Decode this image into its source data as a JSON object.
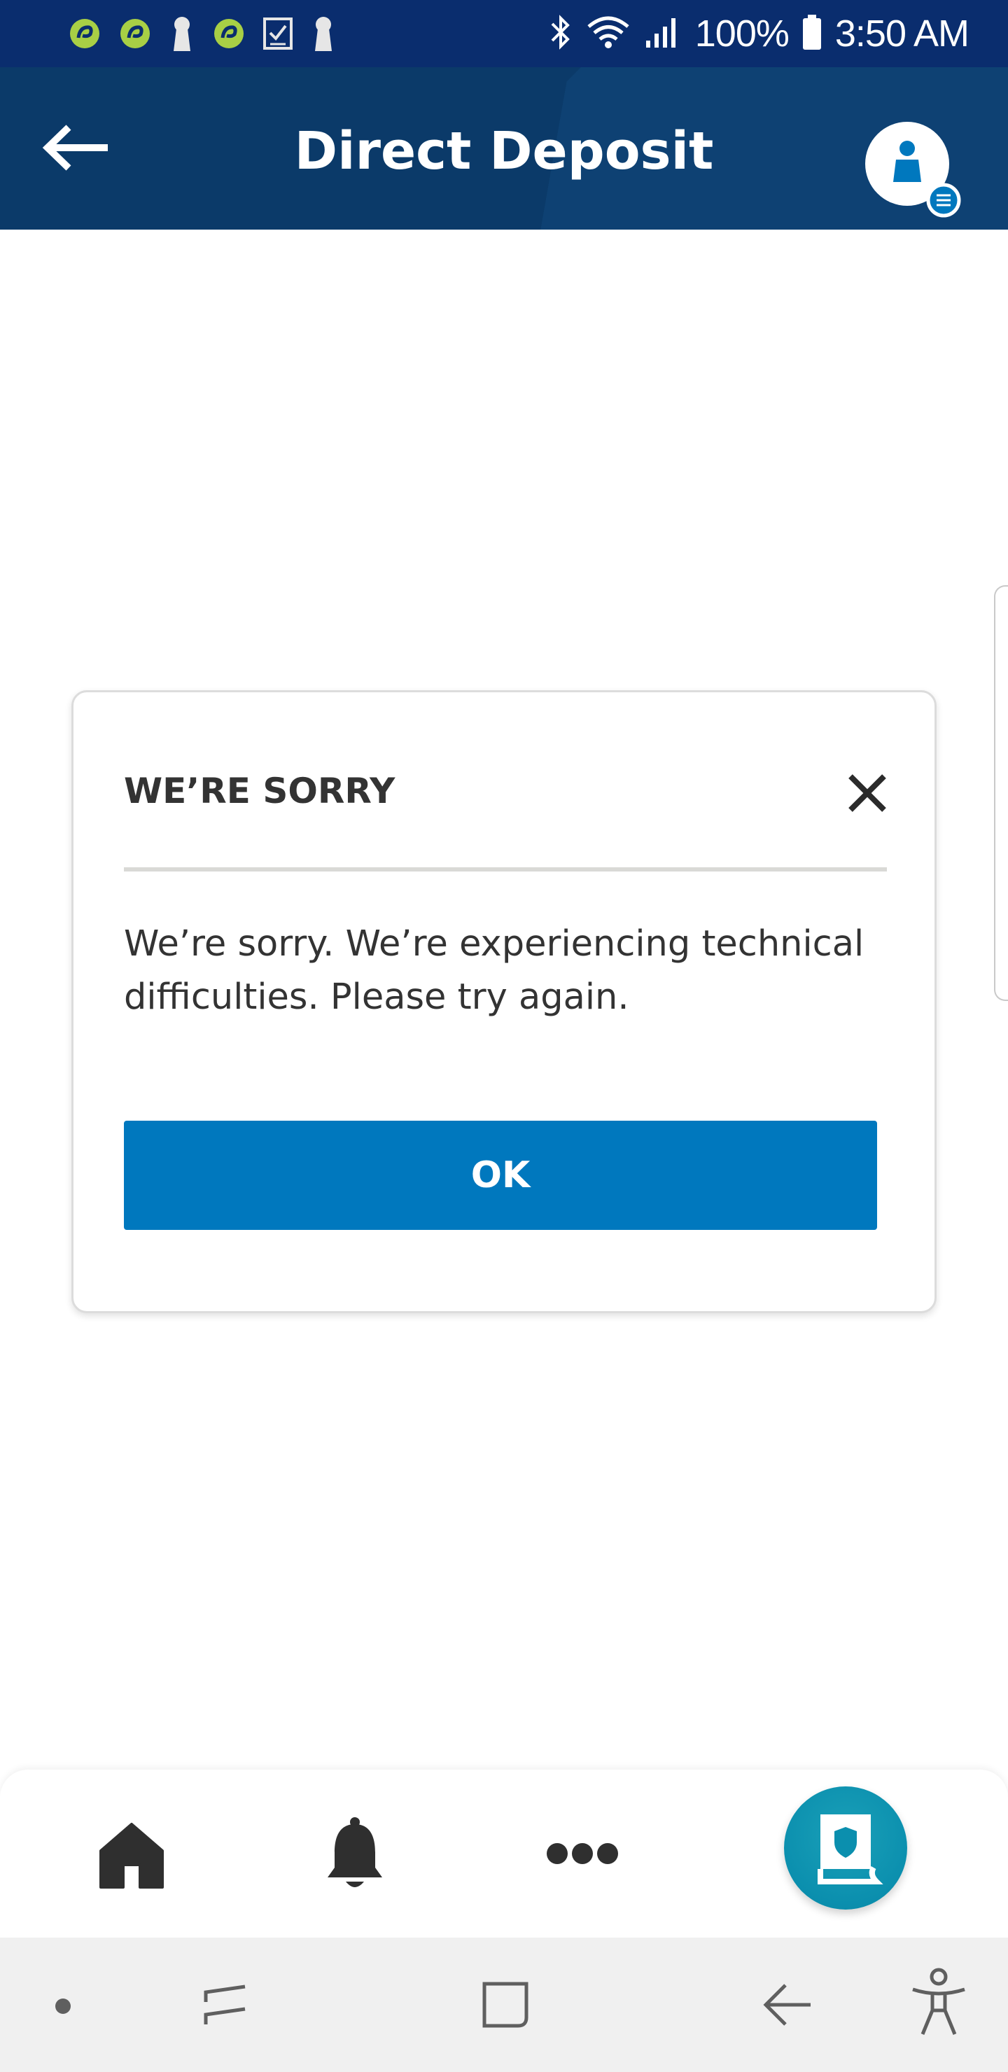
{
  "status_bar": {
    "battery": "100%",
    "time": "3:50 AM",
    "notification_icons": [
      "app-notification-icon",
      "app-notification-icon",
      "keyhole-icon",
      "app-notification-icon",
      "checklist-icon",
      "keyhole-icon"
    ],
    "system_icons": [
      "bluetooth-icon",
      "wifi-icon",
      "signal-icon",
      "battery-icon"
    ]
  },
  "header": {
    "title": "Direct Deposit",
    "back_icon": "back-arrow-icon",
    "profile_icon": "profile-menu-icon"
  },
  "dialog": {
    "title": "WE’RE SORRY",
    "message": "We’re sorry. We’re experiencing technical difficulties. Please try again.",
    "ok_label": "OK",
    "close_icon": "close-icon"
  },
  "bottom_nav": {
    "items": [
      "home-icon",
      "bell-icon",
      "more-icon",
      "secure-message-icon"
    ]
  },
  "system_nav": {
    "items": [
      "dot-icon",
      "recent-apps-icon",
      "home-square-icon",
      "back-icon",
      "accessibility-icon"
    ]
  },
  "colors": {
    "status_bar": "#0a2d6e",
    "header": "#0b3a69",
    "primary_button": "#0078be",
    "fab": "#0b8fae",
    "notification_green": "#a8cf45"
  }
}
